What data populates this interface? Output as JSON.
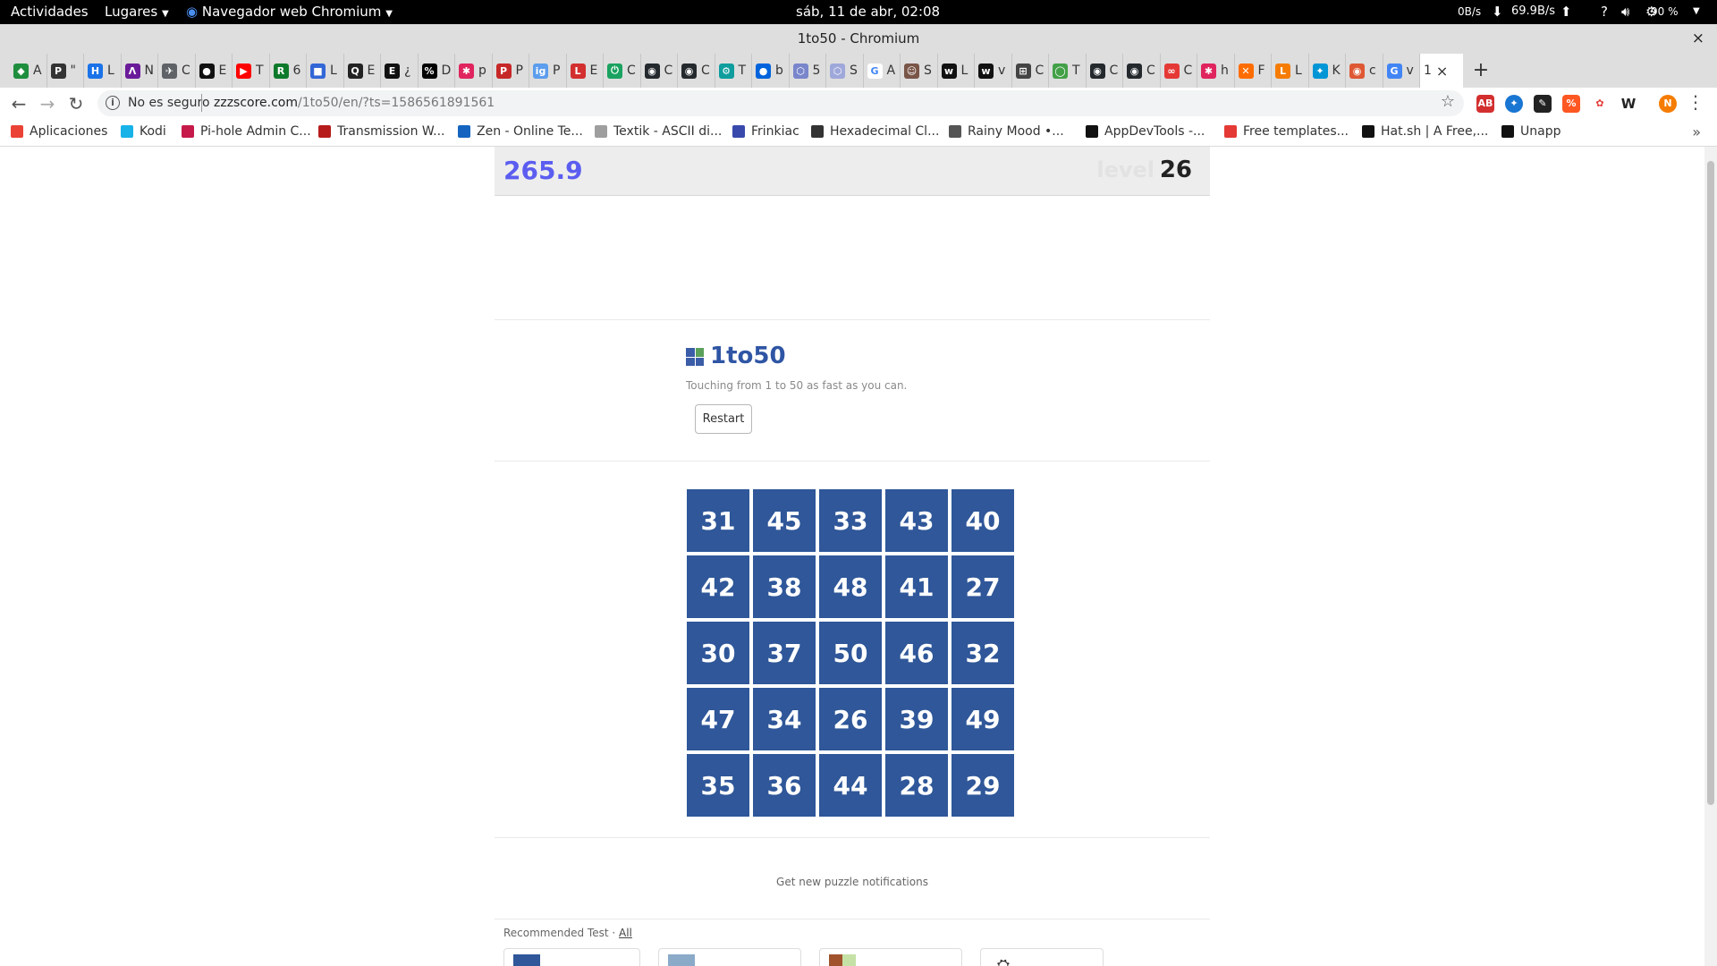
{
  "gnome_bar": {
    "activities": "Actividades",
    "places": "Lugares",
    "app_name": "Navegador web Chromium",
    "clock": "sáb, 11 de abr, 02:08",
    "net_up": "0B/s",
    "net_down": "69.9B/s",
    "battery": "90 %"
  },
  "window": {
    "title": "1to50 - Chromium",
    "close": "×"
  },
  "tabs": [
    {
      "fav_color": "#1e8e3e",
      "glyph": "◆",
      "label": "A"
    },
    {
      "fav_color": "#333333",
      "glyph": "P",
      "label": "\""
    },
    {
      "fav_color": "#1a73e8",
      "glyph": "H",
      "label": "L"
    },
    {
      "fav_color": "#6a1b9a",
      "glyph": "Λ",
      "label": "N"
    },
    {
      "fav_color": "#5f6368",
      "glyph": "✈",
      "label": "C"
    },
    {
      "fav_color": "#111111",
      "glyph": "●",
      "label": "E"
    },
    {
      "fav_color": "#ff0000",
      "glyph": "▶",
      "label": "T"
    },
    {
      "fav_color": "#0d7a2b",
      "glyph": "R",
      "label": "6"
    },
    {
      "fav_color": "#3367d6",
      "glyph": "■",
      "label": "L"
    },
    {
      "fav_color": "#222222",
      "glyph": "Q",
      "label": "E"
    },
    {
      "fav_color": "#111111",
      "glyph": "E",
      "label": "¿"
    },
    {
      "fav_color": "#000000",
      "glyph": "%",
      "label": "D"
    },
    {
      "fav_color": "#e0245e",
      "glyph": "✱",
      "label": "p"
    },
    {
      "fav_color": "#c62828",
      "glyph": "P",
      "label": "P"
    },
    {
      "fav_color": "#5c9ded",
      "glyph": "ig",
      "label": "P"
    },
    {
      "fav_color": "#d32f2f",
      "glyph": "L",
      "label": "E"
    },
    {
      "fav_color": "#1aa260",
      "glyph": "⏻",
      "label": "C"
    },
    {
      "fav_color": "#24292e",
      "glyph": "◉",
      "label": "C"
    },
    {
      "fav_color": "#24292e",
      "glyph": "◉",
      "label": "C"
    },
    {
      "fav_color": "#0f9d9d",
      "glyph": "⚙",
      "label": "T"
    },
    {
      "fav_color": "#0063dc",
      "glyph": "●",
      "label": "b"
    },
    {
      "fav_color": "#7986cb",
      "glyph": "⬡",
      "label": "5"
    },
    {
      "fav_color": "#9fa8da",
      "glyph": "⬡",
      "label": "S"
    },
    {
      "fav_color": "#ffffff",
      "glyph": "G",
      "label": "A"
    },
    {
      "fav_color": "#795548",
      "glyph": "☺",
      "label": "S"
    },
    {
      "fav_color": "#111111",
      "glyph": "w",
      "label": "L"
    },
    {
      "fav_color": "#111111",
      "glyph": "w",
      "label": "v"
    },
    {
      "fav_color": "#444444",
      "glyph": "⊞",
      "label": "C"
    },
    {
      "fav_color": "#43a047",
      "glyph": "◯",
      "label": "T"
    },
    {
      "fav_color": "#24292e",
      "glyph": "◉",
      "label": "C"
    },
    {
      "fav_color": "#24292e",
      "glyph": "◉",
      "label": "C"
    },
    {
      "fav_color": "#e53935",
      "glyph": "∞",
      "label": "C"
    },
    {
      "fav_color": "#e0245e",
      "glyph": "✱",
      "label": "h"
    },
    {
      "fav_color": "#ff6d00",
      "glyph": "✕",
      "label": "F"
    },
    {
      "fav_color": "#f57c00",
      "glyph": "L",
      "label": "L"
    },
    {
      "fav_color": "#0096d6",
      "glyph": "✦",
      "label": "K"
    },
    {
      "fav_color": "#de5833",
      "glyph": "◉",
      "label": "c"
    },
    {
      "fav_color": "#4285f4",
      "glyph": "G",
      "label": "v"
    }
  ],
  "active_tab": {
    "label": "1"
  },
  "toolbar": {
    "not_secure": "No es seguro",
    "url_host": "zzzscore.com",
    "url_path": "/1to50/en/?ts=1586561891561"
  },
  "bookmarks": [
    {
      "label": "Aplicaciones",
      "color": "#ea4335"
    },
    {
      "label": "Kodi",
      "color": "#17b2e7"
    },
    {
      "label": "Pi-hole Admin C...",
      "color": "#c51a4a"
    },
    {
      "label": "Transmission W...",
      "color": "#b71c1c"
    },
    {
      "label": "Zen - Online Te...",
      "color": "#1565c0"
    },
    {
      "label": "Textik - ASCII di...",
      "color": "#9e9e9e"
    },
    {
      "label": "Frinkiac",
      "color": "#3949ab"
    },
    {
      "label": "Hexadecimal Cl...",
      "color": "#333333"
    },
    {
      "label": "Rainy Mood •...",
      "color": "#555555"
    },
    {
      "label": "AppDevTools -...",
      "color": "#111111"
    },
    {
      "label": "Free templates...",
      "color": "#e53935"
    },
    {
      "label": "Hat.sh | A Free,...",
      "color": "#111111"
    },
    {
      "label": "Unapp",
      "color": "#111111"
    }
  ],
  "game": {
    "time": "265.9",
    "next_label": "level",
    "next_value": "26",
    "title": "1to50",
    "description": "Touching from 1 to 50 as fast as you can.",
    "restart_label": "Restart",
    "cells": [
      31,
      45,
      33,
      43,
      40,
      42,
      38,
      48,
      41,
      27,
      30,
      37,
      50,
      46,
      32,
      47,
      34,
      26,
      39,
      49,
      35,
      36,
      44,
      28,
      29
    ]
  },
  "footer": {
    "notify": "Get new puzzle notifications",
    "recommended": "Recommended Test · ",
    "all_link": "All"
  }
}
